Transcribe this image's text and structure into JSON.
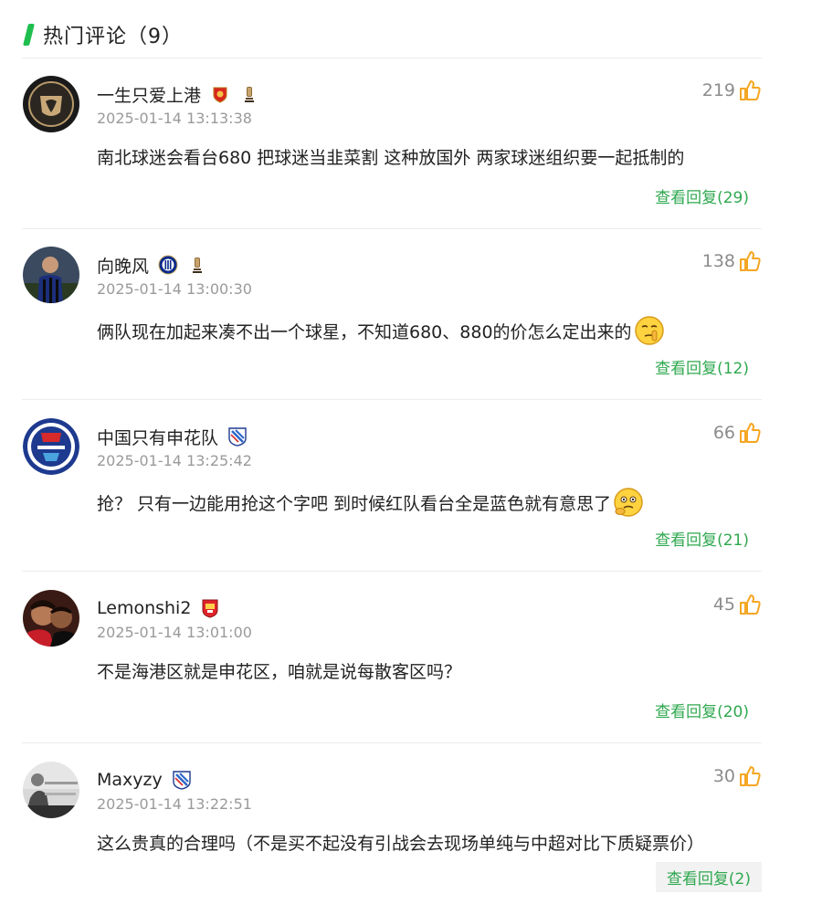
{
  "header": {
    "title": "热门评论（9）"
  },
  "colors": {
    "accent_green": "#1fbf4f",
    "reply_green": "#2fa84f",
    "like_orange": "#f5a623",
    "meta_gray": "#9a9a9a"
  },
  "comments": [
    {
      "username": "一生只爱上港",
      "badges": [
        "shanghai-port-badge-icon",
        "trophy-icon"
      ],
      "time": "2025-01-14 13:13:38",
      "likes": "219",
      "content": "南北球迷会看台680 把球迷当韭菜割 这种放国外 两家球迷组织要一起抵制的",
      "emoji": "",
      "reply_label": "查看回复(29)"
    },
    {
      "username": "向晚风",
      "badges": [
        "inter-badge-icon",
        "trophy-icon"
      ],
      "time": "2025-01-14 13:00:30",
      "likes": "138",
      "content": "俩队现在加起来凑不出一个球星，不知道680、880的价怎么定出来的",
      "emoji": "shush-face-emoji",
      "reply_label": "查看回复(12)"
    },
    {
      "username": "中国只有申花队",
      "badges": [
        "shenhua-badge-icon"
      ],
      "time": "2025-01-14 13:25:42",
      "likes": "66",
      "content": "抢？ 只有一边能用抢这个字吧 到时候红队看台全是蓝色就有意思了",
      "emoji": "thinking-face-emoji",
      "reply_label": "查看回复(21)"
    },
    {
      "username": "Lemonshi2",
      "badges": [
        "club-shield-badge-icon"
      ],
      "time": "2025-01-14 13:01:00",
      "likes": "45",
      "content": "不是海港区就是申花区，咱就是说每散客区吗？",
      "emoji": "",
      "reply_label": "查看回复(20)"
    },
    {
      "username": "Maxyzy",
      "badges": [
        "shenhua-badge-icon"
      ],
      "time": "2025-01-14 13:22:51",
      "likes": "30",
      "content": "这么贵真的合理吗（不是买不起没有引战会去现场单纯与中超对比下质疑票价）",
      "emoji": "",
      "reply_label": "查看回复(2)"
    }
  ]
}
